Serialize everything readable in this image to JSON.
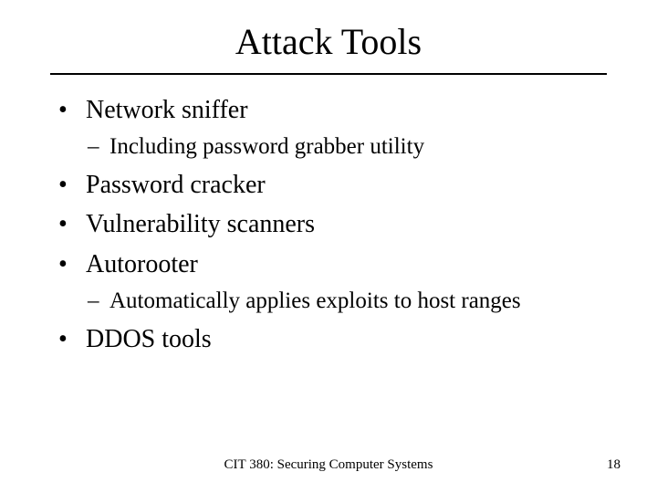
{
  "title": "Attack Tools",
  "bullets": {
    "b0": "Network sniffer",
    "b0_sub": "Including password grabber utility",
    "b1": "Password cracker",
    "b2": "Vulnerability scanners",
    "b3": "Autorooter",
    "b3_sub": "Automatically applies exploits to host ranges",
    "b4": "DDOS tools"
  },
  "footer": {
    "course": "CIT 380: Securing Computer Systems",
    "page": "18"
  },
  "glyphs": {
    "bullet": "•",
    "dash": "–"
  }
}
